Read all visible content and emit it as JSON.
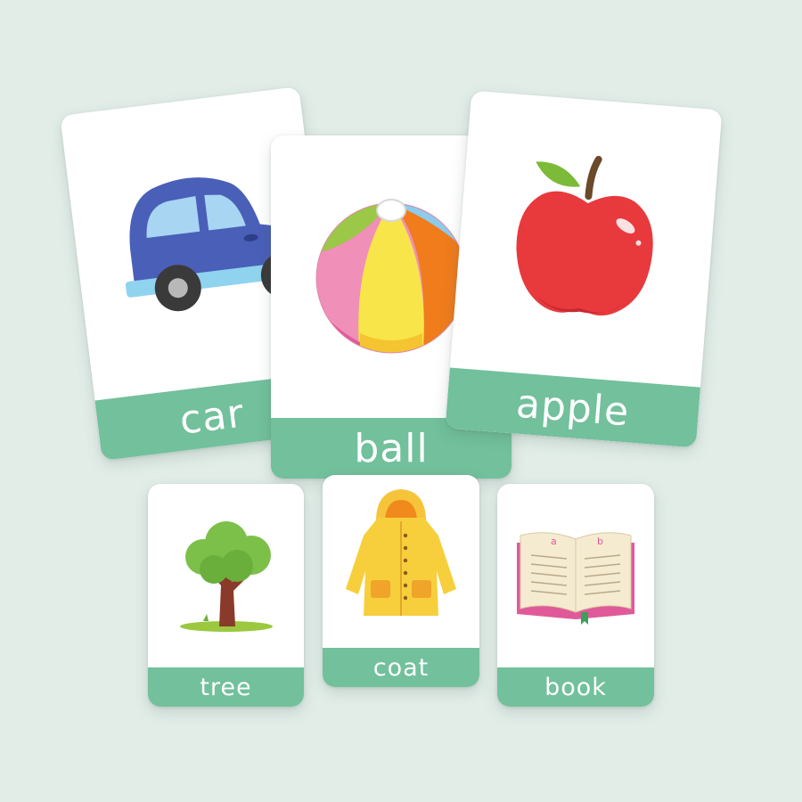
{
  "cards": {
    "car": {
      "word": "car",
      "icon": "car-icon"
    },
    "ball": {
      "word": "ball",
      "icon": "beach-ball-icon"
    },
    "apple": {
      "word": "apple",
      "icon": "apple-icon"
    },
    "tree": {
      "word": "tree",
      "icon": "tree-icon"
    },
    "coat": {
      "word": "coat",
      "icon": "raincoat-icon"
    },
    "book": {
      "word": "book",
      "icon": "book-icon",
      "page_letters": [
        "a",
        "b"
      ]
    }
  },
  "colors": {
    "background": "#e2ede8",
    "label_band": "#72c09c",
    "card": "#ffffff"
  }
}
